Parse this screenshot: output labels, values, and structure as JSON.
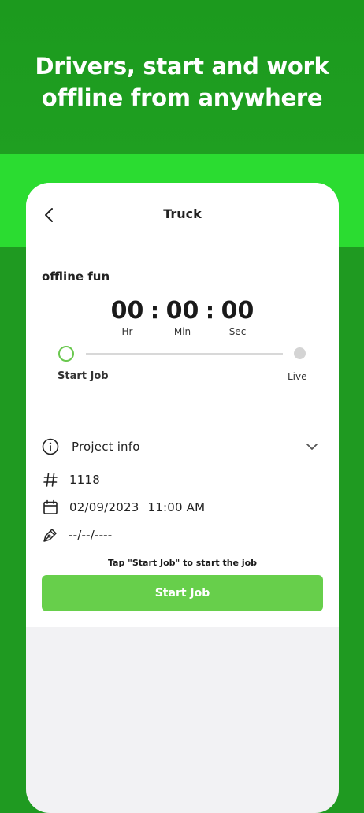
{
  "headline": {
    "line1": "Drivers, start and work",
    "line2": "offline from anywhere"
  },
  "nav": {
    "title": "Truck",
    "back_icon": "chevron-left-icon"
  },
  "job": {
    "name": "offline fun"
  },
  "timer": {
    "hours": "00",
    "minutes": "00",
    "seconds": "00",
    "separator": ":",
    "hours_label": "Hr",
    "minutes_label": "Min",
    "seconds_label": "Sec"
  },
  "progress": {
    "start_label": "Start Job",
    "end_label": "Live"
  },
  "project_info": {
    "label": "Project info",
    "number": "1118",
    "date": "02/09/2023",
    "time": "11:00 AM",
    "signature": "--/--/----"
  },
  "action": {
    "hint": "Tap \"Start Job\" to start the job",
    "button_label": "Start Job"
  },
  "colors": {
    "brand_green": "#1f9a21",
    "band_green": "#2bdc31",
    "button_green": "#67cf4b"
  }
}
